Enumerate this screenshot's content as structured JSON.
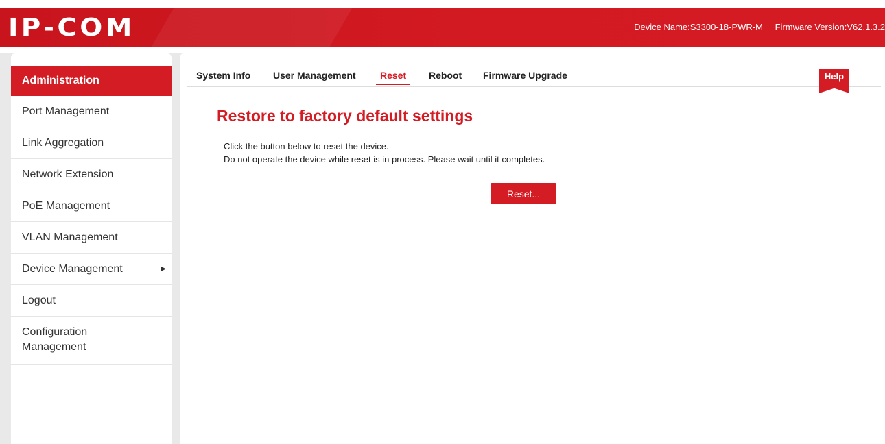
{
  "header": {
    "logo": "IP-COM",
    "device_name": "Device Name:S3300-18-PWR-M",
    "firmware_version": "Firmware Version:V62.1.3.2"
  },
  "sidebar": {
    "active": "Administration",
    "items": [
      {
        "label": "Port Management"
      },
      {
        "label": "Link Aggregation"
      },
      {
        "label": "Network Extension"
      },
      {
        "label": "PoE Management"
      },
      {
        "label": "VLAN Management"
      },
      {
        "label": "Device Management",
        "arrow": "▶"
      },
      {
        "label": "Logout"
      },
      {
        "label": "Configuration Management"
      }
    ]
  },
  "tabs": [
    {
      "label": "System Info"
    },
    {
      "label": "User Management"
    },
    {
      "label": "Reset",
      "active": true
    },
    {
      "label": "Reboot"
    },
    {
      "label": "Firmware Upgrade"
    }
  ],
  "help_label": "Help",
  "content": {
    "title": "Restore to factory default settings",
    "line1": "Click the button below to reset the device.",
    "line2": "Do not operate the device while reset is in process. Please wait until it completes.",
    "button_label": "Reset..."
  },
  "colors": {
    "accent": "#d31c23"
  }
}
